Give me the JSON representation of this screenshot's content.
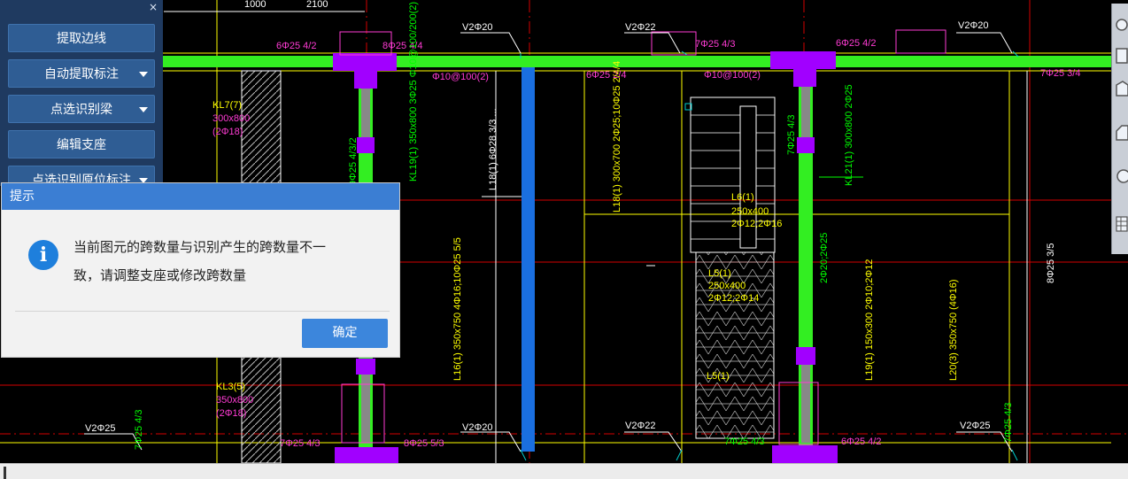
{
  "sidepanel": {
    "close_glyph": "×",
    "buttons": [
      {
        "label": "提取边线",
        "dropdown": false
      },
      {
        "label": "自动提取标注",
        "dropdown": true
      },
      {
        "label": "点选识别梁",
        "dropdown": true
      },
      {
        "label": "编辑支座",
        "dropdown": false
      },
      {
        "label": "点选识别原位标注",
        "dropdown": true
      }
    ]
  },
  "dialog": {
    "title": "提示",
    "message_line1": "当前图元的跨数量与识别产生的跨数量不一",
    "message_line2": "致，请调整支座或修改跨数量",
    "ok_label": "确定",
    "icon": "info-icon"
  },
  "right_toolbar": {
    "icons": [
      "zoom-icon",
      "rectangle-icon",
      "cube-top-icon",
      "cube-side-icon",
      "circle-icon",
      "grid-icon"
    ]
  },
  "drawing": {
    "texts": [
      {
        "t": "1000",
        "c": "#ffffff"
      },
      {
        "t": "2100",
        "c": "#ffffff"
      },
      {
        "t": "V2Φ20",
        "c": "#ffffff"
      },
      {
        "t": "V2Φ22",
        "c": "#ffffff"
      },
      {
        "t": "V2Φ20",
        "c": "#ffffff"
      },
      {
        "t": "6Φ25 4/2",
        "c": "#ff3bd4"
      },
      {
        "t": "8Φ25 4/4",
        "c": "#ff3bd4"
      },
      {
        "t": "7Φ25 4/3",
        "c": "#ff3bd4"
      },
      {
        "t": "6Φ25 4/2",
        "c": "#ff3bd4"
      },
      {
        "t": "7Φ25 3/4",
        "c": "#ff3bd4"
      },
      {
        "t": "Φ10@100(2)",
        "c": "#ff3bd4"
      },
      {
        "t": "6Φ25 2/4",
        "c": "#ff3bd4"
      },
      {
        "t": "Φ10@100(2)",
        "c": "#ff3bd4"
      },
      {
        "t": "KL7(7)",
        "c": "#ffff00"
      },
      {
        "t": "300x800",
        "c": "#ff3bd4"
      },
      {
        "t": "(2Φ18)",
        "c": "#ff3bd4"
      },
      {
        "t": "KL3(5)",
        "c": "#ffff00"
      },
      {
        "t": "350x800",
        "c": "#ff3bd4"
      },
      {
        "t": "(2Φ18)",
        "c": "#ff3bd4"
      },
      {
        "t": "V2Φ25",
        "c": "#ffffff"
      },
      {
        "t": "7Φ25 4/3",
        "c": "#ff3bd4"
      },
      {
        "t": "8Φ25 5/3",
        "c": "#ff3bd4"
      },
      {
        "t": "V2Φ20",
        "c": "#ffffff"
      },
      {
        "t": "V2Φ22",
        "c": "#ffffff"
      },
      {
        "t": "6Φ25 4/2",
        "c": "#ff3bd4"
      },
      {
        "t": "V2Φ25",
        "c": "#ffffff"
      },
      {
        "t": "7Φ25 4/3",
        "c": "#00ff00"
      },
      {
        "t": "L6(1)",
        "c": "#ffff00"
      },
      {
        "t": "250x400",
        "c": "#ffff00"
      },
      {
        "t": "2Φ12;2Φ16",
        "c": "#ffff00"
      },
      {
        "t": "L5(1)",
        "c": "#ffff00"
      },
      {
        "t": "250x400",
        "c": "#ffff00"
      },
      {
        "t": "2Φ12;2Φ14",
        "c": "#ffff00"
      },
      {
        "t": "L5(1)",
        "c": "#ffff00"
      }
    ],
    "vtexts": [
      {
        "t": "9Φ25 4/3/2",
        "c": "#00ff00"
      },
      {
        "t": "KL19(1) 350x800 3Φ25 Φ10@100/200(2)",
        "c": "#00ff00"
      },
      {
        "t": "L18(1) 6Φ28 3/3 ...",
        "c": "#ffffff"
      },
      {
        "t": "L18(1) 300x700 2Φ25;10Φ25 2/4/4",
        "c": "#ffff00"
      },
      {
        "t": "7Φ25 4/3",
        "c": "#00ff00"
      },
      {
        "t": "KL21(1) 300x800 2Φ25",
        "c": "#00ff00"
      },
      {
        "t": "2Φ20;2Φ25",
        "c": "#00ff00"
      },
      {
        "t": "8Φ25 3/5",
        "c": "#ffffff"
      },
      {
        "t": "L16(1) 350x750 4Φ16;10Φ25 5/5",
        "c": "#ffff00"
      },
      {
        "t": "L19(1) 150x300 2Φ10;2Φ12",
        "c": "#ffff00"
      },
      {
        "t": "L20(3) 350x750 (4Φ16)",
        "c": "#ffff00"
      },
      {
        "t": "7Φ25 4/3",
        "c": "#00ff00"
      },
      {
        "t": "7Φ25 4/3",
        "c": "#00ff00"
      }
    ]
  },
  "statusbar": {
    "text": ""
  }
}
